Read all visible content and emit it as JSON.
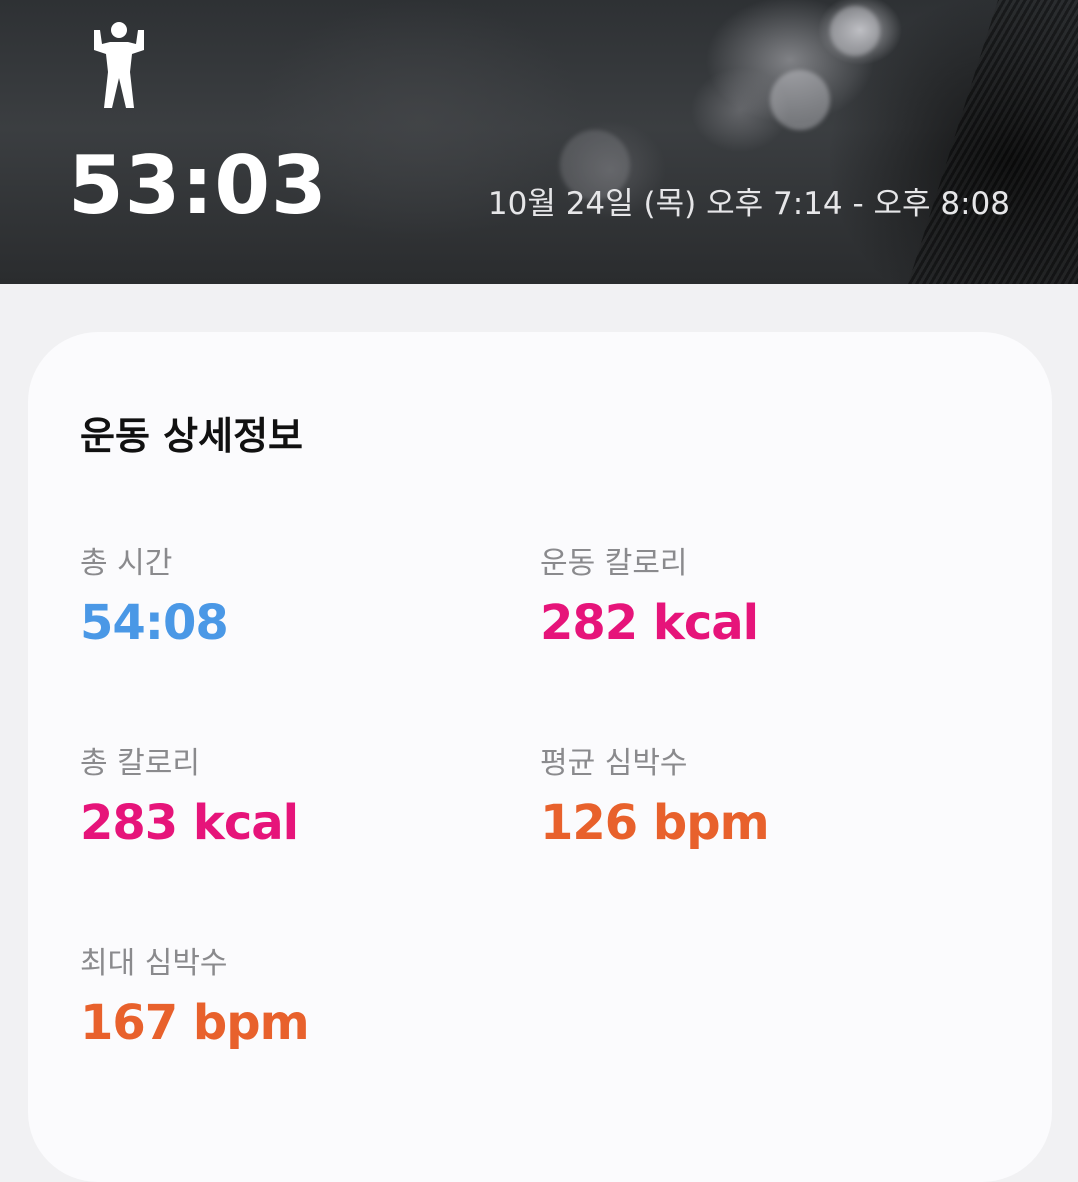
{
  "header": {
    "icon": "person-flexing-icon",
    "duration": "53:03",
    "time_range": "10월 24일 (목) 오후 7:14 - 오후 8:08"
  },
  "details": {
    "title": "운동 상세정보",
    "total_time": {
      "label": "총 시간",
      "value": "54:08"
    },
    "workout_calories": {
      "label": "운동 칼로리",
      "value": "282 kcal"
    },
    "total_calories": {
      "label": "총 칼로리",
      "value": "283 kcal"
    },
    "avg_heart_rate": {
      "label": "평균 심박수",
      "value": "126 bpm"
    },
    "max_heart_rate": {
      "label": "최대 심박수",
      "value": "167 bpm"
    }
  },
  "colors": {
    "time": "#4a98e6",
    "calories": "#e6147a",
    "heart_rate": "#e8612c"
  }
}
